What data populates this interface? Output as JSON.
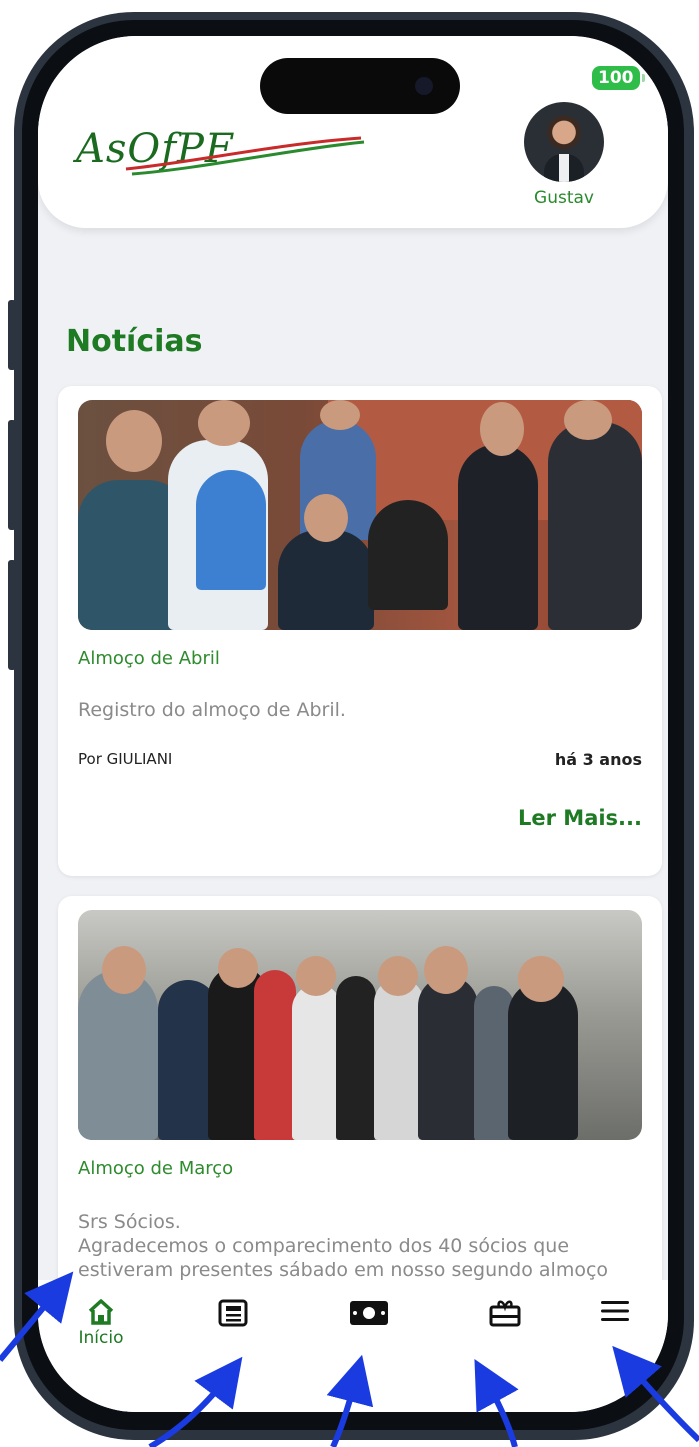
{
  "status_bar": {
    "battery": "100"
  },
  "header": {
    "logo_text": "AsOfPF",
    "user_name": "Gustav"
  },
  "section_title": "Notícias",
  "news": [
    {
      "title": "Almoço de Abril",
      "description": "Registro do almoço de Abril.",
      "author": "Por  GIULIANI",
      "time": "há 3 anos",
      "read_more": "Ler Mais..."
    },
    {
      "title": "Almoço de Março",
      "description_line1": "Srs Sócios.",
      "description_line2": "Agradecemos o comparecimento dos 40 sócios que",
      "description_line3": "estiveram presentes sábado em nosso segundo almoço"
    }
  ],
  "tabbar": {
    "home_label": "Início",
    "items": [
      "home-icon",
      "news-icon",
      "money-icon",
      "gift-card-icon",
      "menu-icon"
    ]
  },
  "colors": {
    "primary_green": "#1e7a23",
    "background": "#eff1f5",
    "arrow": "#1a3be0"
  }
}
